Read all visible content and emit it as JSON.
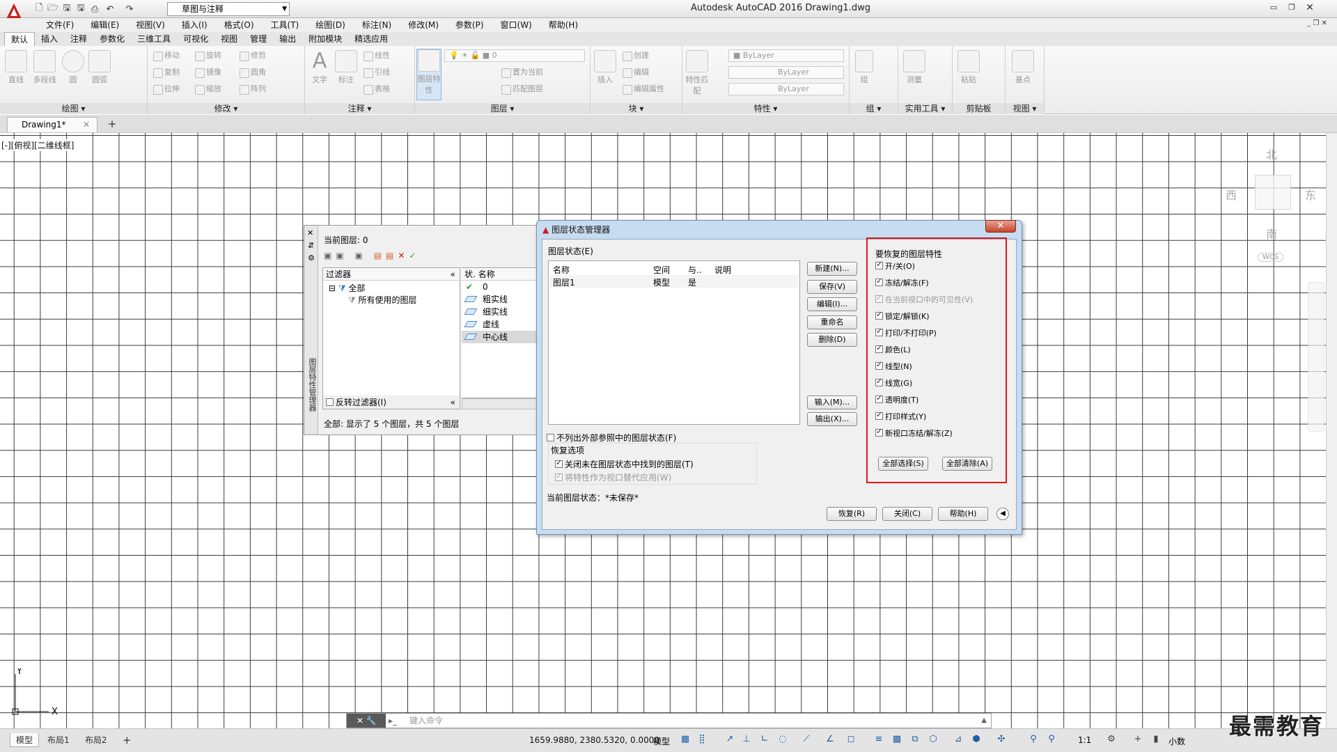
{
  "app": {
    "title": "Autodesk AutoCAD 2016    Drawing1.dwg",
    "workspace": "草图与注释"
  },
  "menu": [
    "文件(F)",
    "编辑(E)",
    "视图(V)",
    "插入(I)",
    "格式(O)",
    "工具(T)",
    "绘图(D)",
    "标注(N)",
    "修改(M)",
    "参数(P)",
    "窗口(W)",
    "帮助(H)"
  ],
  "ribbon_tabs": [
    "默认",
    "插入",
    "注释",
    "参数化",
    "三维工具",
    "可视化",
    "视图",
    "管理",
    "输出",
    "附加模块",
    "精选应用"
  ],
  "ribbon": {
    "draw": {
      "title": "绘图",
      "tools": [
        "直线",
        "多段线",
        "圆",
        "圆弧"
      ]
    },
    "modify": {
      "title": "修改",
      "tools": [
        "移动",
        "旋转",
        "修剪",
        "复制",
        "镜像",
        "圆角",
        "拉伸",
        "缩放",
        "阵列"
      ]
    },
    "annotation": {
      "title": "注释",
      "tools": [
        "文字",
        "标注",
        "线性",
        "引线",
        "表格"
      ]
    },
    "layers": {
      "title": "图层",
      "big": "图层特性",
      "tools": [
        "置为当前",
        "匹配图层"
      ],
      "current": "0"
    },
    "block": {
      "title": "块",
      "tools": [
        "插入",
        "创建",
        "编辑",
        "编辑属性"
      ]
    },
    "properties": {
      "title": "特性",
      "big": "特性匹配",
      "color": "ByLayer",
      "linetype": "ByLayer",
      "lineweight": "ByLayer"
    },
    "groups": {
      "title": "组",
      "big": "组"
    },
    "utilities": {
      "title": "实用工具",
      "big": "测量"
    },
    "clipboard": {
      "title": "剪贴板",
      "big": "粘贴"
    },
    "view": {
      "title": "视图",
      "big": "基点"
    }
  },
  "document_tab": "Drawing1*",
  "viewport_controls": "[-][俯视][二维线框]",
  "viewcube": {
    "north": "北",
    "south": "南",
    "east": "东",
    "west": "西",
    "wcs": "WCS"
  },
  "layer_palette": {
    "side_title": "图层特性管理器",
    "current_layer": "当前图层: 0",
    "filters_header": "过滤器",
    "filter_all": "全部",
    "filter_used": "所有使用的图层",
    "invert_filter": "反转过滤器(I)",
    "list_header_status": "状.",
    "list_header_name": "名称",
    "layers": [
      "0",
      "粗实线",
      "细实线",
      "虚线",
      "中心线"
    ],
    "status": "全部: 显示了 5 个图层，共 5 个图层"
  },
  "dialog": {
    "title": "图层状态管理器",
    "states_label": "图层状态(E)",
    "columns": [
      "名称",
      "空间",
      "与..",
      "说明"
    ],
    "row": {
      "name": "图层1",
      "space": "模型",
      "same": "是",
      "desc": ""
    },
    "buttons_right": [
      "新建(N)...",
      "保存(V)",
      "编辑(I)...",
      "重命名",
      "删除(D)",
      "输入(M)...",
      "输出(X)..."
    ],
    "exclude_xref": "不列出外部参照中的图层状态(F)",
    "restore_options": "恢复选项",
    "close_missing": "关闭未在图层状态中找到的图层(T)",
    "apply_viewport": "将特性作为视口替代应用(W)",
    "current_state": "当前图层状态：*未保存*",
    "bottom_buttons": [
      "恢复(R)",
      "关闭(C)",
      "帮助(H)"
    ],
    "props_title": "要恢复的图层特性",
    "props": [
      {
        "label": "开/关(O)",
        "checked": true,
        "enabled": true
      },
      {
        "label": "冻结/解冻(F)",
        "checked": true,
        "enabled": true
      },
      {
        "label": "在当前视口中的可见性(V)",
        "checked": true,
        "enabled": false
      },
      {
        "label": "锁定/解锁(K)",
        "checked": true,
        "enabled": true
      },
      {
        "label": "打印/不打印(P)",
        "checked": true,
        "enabled": true
      },
      {
        "label": "颜色(L)",
        "checked": true,
        "enabled": true
      },
      {
        "label": "线型(N)",
        "checked": true,
        "enabled": true
      },
      {
        "label": "线宽(G)",
        "checked": true,
        "enabled": true
      },
      {
        "label": "透明度(T)",
        "checked": true,
        "enabled": true
      },
      {
        "label": "打印样式(Y)",
        "checked": true,
        "enabled": true
      },
      {
        "label": "新视口冻结/解冻(Z)",
        "checked": true,
        "enabled": true
      }
    ],
    "select_all": "全部选择(S)",
    "clear_all": "全部清除(A)"
  },
  "command_line": {
    "placeholder": "键入命令"
  },
  "status_bar": {
    "layout_tabs": [
      "模型",
      "布局1",
      "布局2"
    ],
    "coords": "1659.9880, 2380.5320, 0.0000",
    "model": "模型",
    "scale": "1:1",
    "units": "小数"
  },
  "watermark": "最需教育",
  "accent_red": "#e0161b"
}
